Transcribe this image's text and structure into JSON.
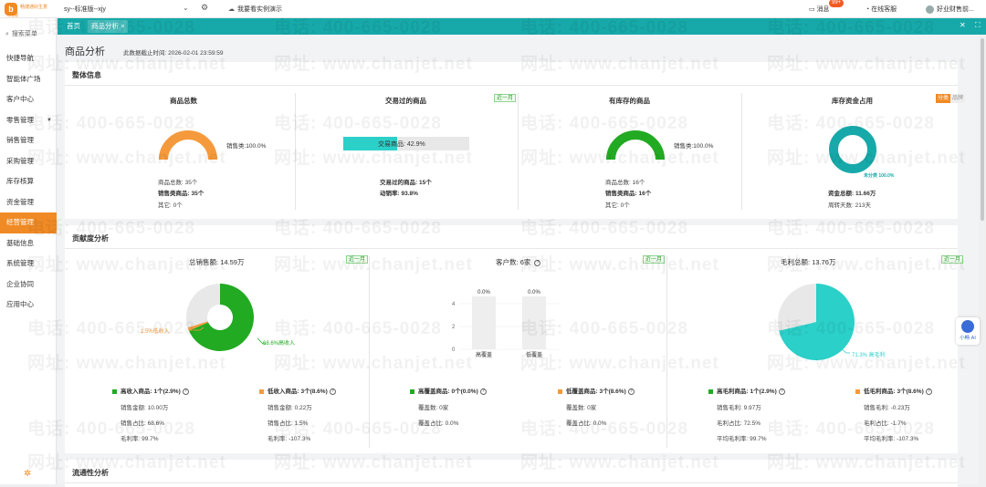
{
  "colors": {
    "accent": "#f08a24",
    "teal": "#17a9a9",
    "green": "#22aa22",
    "cyan": "#2bd0c8",
    "orange": "#f59a3c"
  },
  "header": {
    "logo_initial": "b",
    "logo_name": "畅捷通好生意",
    "logo_sub": "标准版",
    "account": "sy--标准版--xjy",
    "demo_label": "我要看实例演示",
    "msg_label": "消息",
    "msg_badge": "99+",
    "service_label": "在线客服",
    "user_name": "好业财售前..."
  },
  "sidebar": {
    "search_placeholder": "搜索菜单",
    "items": [
      "快捷导航",
      "智能体广场",
      "客户中心",
      "零售管理",
      "销售管理",
      "采购管理",
      "库存核算",
      "资金管理",
      "经营管理",
      "基础信息",
      "系统管理",
      "企业协同",
      "应用中心"
    ],
    "active_index": 8
  },
  "tabs": {
    "home": "首页",
    "current": "商品分析",
    "close": "×"
  },
  "page": {
    "title": "商品分析",
    "time_label": "此数据截止时间:",
    "time_value": "2026-02-01 23:59:59"
  },
  "overall": {
    "title": "整体信息",
    "total": {
      "title": "商品总数",
      "legend": "销售类:100.0%",
      "gauge_ratio": 1.0,
      "lines": [
        "商品总数:  35个",
        "销售类商品:  35个",
        "其它:  0个"
      ]
    },
    "traded": {
      "title": "交易过的商品",
      "period": "近一月",
      "bar_label": "交易商品:",
      "bar_value": "42.9%",
      "bar_ratio": 0.429,
      "lines": [
        "交易过的商品:  15个",
        "动销率:  93.8%"
      ]
    },
    "stock": {
      "title": "有库存的商品",
      "legend": "销售类:100.0%",
      "gauge_ratio": 1.0,
      "lines": [
        "商品总数:  16个",
        "销售类商品:  16个",
        "其它:  0个"
      ]
    },
    "capital": {
      "title": "库存资金占用",
      "toggle_on": "分类",
      "toggle_off": "品牌",
      "donut_label": "未分类  100.0%",
      "donut_ratio": 1.0,
      "lines": [
        "资金总额:  11.66万",
        "周转天数:  213天"
      ]
    }
  },
  "contrib": {
    "title": "贡献度分析",
    "sales": {
      "title": "总销售额:",
      "value": "14.59万",
      "period": "近一月",
      "pie": [
        {
          "label": "68.6%高收入",
          "value": 68.6,
          "color": "#22aa22"
        },
        {
          "label": "1.5%低收入",
          "value": 1.5,
          "color": "#f59a3c"
        },
        {
          "label": "",
          "value": 29.9,
          "color": "#e8e8e8"
        }
      ]
    },
    "customers": {
      "title": "客户数:",
      "value": "6家",
      "period": "近一月",
      "bars": [
        {
          "category": "高覆盖",
          "value": 0.0,
          "label": "0.0%"
        },
        {
          "category": "低覆盖",
          "value": 0.0,
          "label": "0.0%"
        }
      ],
      "yticks": [
        "4",
        "2",
        "0"
      ]
    },
    "margin": {
      "title": "毛利总额:",
      "value": "13.76万",
      "period": "近一月",
      "pie": [
        {
          "label": "71.3% 高毛利",
          "value": 71.3,
          "color": "#2bd0c8"
        },
        {
          "label": "",
          "value": 28.7,
          "color": "#e8e8e8"
        }
      ]
    },
    "groups": [
      {
        "title": "高收入商品:",
        "count": "1个(2.9%)",
        "color": "#22aa22",
        "metrics": [
          "销售金额:  10.00万",
          "销售占比:  68.6%",
          "毛利率:  99.7%"
        ]
      },
      {
        "title": "低收入商品:",
        "count": "3个(8.6%)",
        "color": "#f59a3c",
        "metrics": [
          "销售金额:  0.22万",
          "销售占比:  1.5%",
          "毛利率:  -107.3%"
        ]
      },
      {
        "title": "高覆盖商品:",
        "count": "0个(0.0%)",
        "color": "#22aa22",
        "metrics": [
          "覆盖数:  0家",
          "覆盖占比:  0.0%"
        ]
      },
      {
        "title": "低覆盖商品:",
        "count": "3个(8.6%)",
        "color": "#f59a3c",
        "metrics": [
          "覆盖数:  0家",
          "覆盖占比:  0.0%"
        ]
      },
      {
        "title": "高毛利商品:",
        "count": "1个(2.9%)",
        "color": "#22aa22",
        "metrics": [
          "销售毛利:  9.97万",
          "毛利占比:  72.5%",
          "平均毛利率:  99.7%"
        ]
      },
      {
        "title": "低毛利商品:",
        "count": "3个(8.6%)",
        "color": "#f59a3c",
        "metrics": [
          "销售毛利:  -0.23万",
          "毛利占比:  -1.7%",
          "平均毛利率:  -107.3%"
        ]
      }
    ]
  },
  "flow": {
    "title": "流通性分析"
  },
  "watermark": {
    "phone": "电话: 400-665-0028",
    "site": "网址: www.chanjet.net"
  },
  "bot": {
    "label": "小畅 AI"
  }
}
